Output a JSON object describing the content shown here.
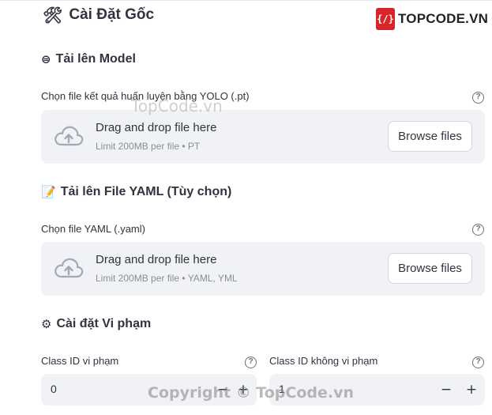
{
  "header": {
    "title": "Cài Đặt Gốc",
    "title_emoji": "🛠",
    "logo_mark": "{/}",
    "logo_text": "TOPCODE.VN"
  },
  "model_section": {
    "emoji": "⊜",
    "title": "Tải lên Model",
    "field_label": "Chọn file kết quả huấn luyện bằng YOLO (.pt)",
    "help": "?",
    "dropzone": {
      "title": "Drag and drop file here",
      "limit": "Limit 200MB per file • PT",
      "button": "Browse files"
    }
  },
  "yaml_section": {
    "emoji": "📝",
    "title": "Tải lên File YAML (Tùy chọn)",
    "field_label": "Chọn file YAML (.yaml)",
    "help": "?",
    "dropzone": {
      "title": "Drag and drop file here",
      "limit": "Limit 200MB per file • YAML, YML",
      "button": "Browse files"
    }
  },
  "violation_section": {
    "emoji": "⚙",
    "title": "Cài đặt Vi phạm",
    "violation_class": {
      "label": "Class ID vi phạm",
      "help": "?",
      "value": "0",
      "minus": "−",
      "plus": "+"
    },
    "non_violation_class": {
      "label": "Class ID không vi phạm",
      "help": "?",
      "value": "1",
      "minus": "−",
      "plus": "+"
    }
  },
  "watermarks": {
    "mid": "TopCode.vn",
    "bottom": "Copyright © TopCode.vn"
  },
  "colors": {
    "input_bg": "#f0f2f6",
    "logo_red": "#d7262a",
    "upload_icon": "#a3a8b8"
  }
}
